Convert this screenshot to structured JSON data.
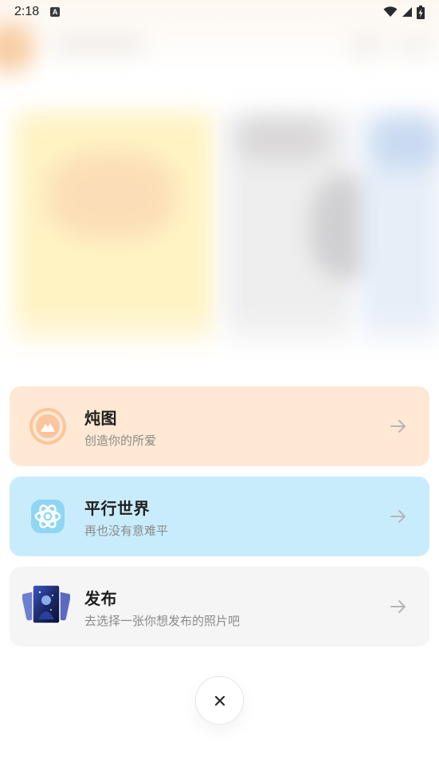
{
  "status_bar": {
    "time": "2:18",
    "notification_icon": "a-letter-icon",
    "right_icons": [
      "wifi-icon",
      "signal-icon",
      "battery-charging-icon"
    ]
  },
  "menu": {
    "options": [
      {
        "icon": "mountain-badge-icon",
        "title": "炖图",
        "subtitle": "创造你的所爱",
        "arrow": "arrow-right-icon",
        "accent": "#ffe9d4"
      },
      {
        "icon": "atom-icon",
        "title": "平行世界",
        "subtitle": "再也没有意难平",
        "arrow": "arrow-right-icon",
        "accent": "#c9ecfc"
      },
      {
        "icon": "photo-stack-icon",
        "title": "发布",
        "subtitle": "去选择一张你想发布的照片吧",
        "arrow": "arrow-right-icon",
        "accent": "#f6f5f5"
      }
    ],
    "close_icon": "close-icon"
  }
}
